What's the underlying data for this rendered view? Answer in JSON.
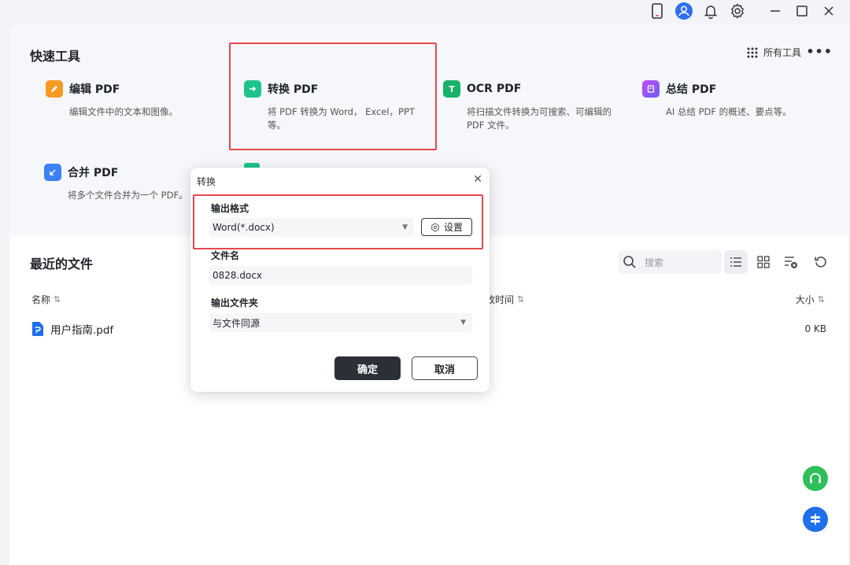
{
  "titlebar": {
    "icons": [
      "phone-icon",
      "user-avatar-icon",
      "bell-icon",
      "gear-icon",
      "minimize-icon",
      "maximize-icon",
      "close-icon"
    ]
  },
  "quick_tools": {
    "title": "快速工具",
    "all_tools_label": "所有工具",
    "more_label": "•••",
    "tools": [
      {
        "name": "编辑 PDF",
        "desc": "编辑文件中的文本和图像。",
        "color": "#f59a23"
      },
      {
        "name": "转换 PDF",
        "desc": "将 PDF 转换为 Word， Excel，PPT 等。",
        "color": "#1ec38b"
      },
      {
        "name": "OCR PDF",
        "desc": "将扫描文件转换为可搜索、可编辑的 PDF 文件。",
        "color": "#17b26a",
        "icon_text": "T"
      },
      {
        "name": "总结 PDF",
        "desc": "AI 总结 PDF 的概述、要点等。",
        "color": "#8b5cf6"
      },
      {
        "name": "合并 PDF",
        "desc": "将多个文件合并为一个 PDF。",
        "color": "#3b82f6"
      }
    ]
  },
  "recent": {
    "title": "最近的文件",
    "search_placeholder": "搜索",
    "columns": {
      "name": "名称",
      "modified": "改时间",
      "size": "大小"
    },
    "sort_glyph": "⇅",
    "files": [
      {
        "name": "用户指南.pdf",
        "size": "0 KB"
      }
    ]
  },
  "dialog": {
    "title": "转换",
    "close_glyph": "✕",
    "output_format_label": "输出格式",
    "output_format_value": "Word(*.docx)",
    "settings_label": "设置",
    "file_name_label": "文件名",
    "file_name_value": "0828.docx",
    "output_folder_label": "输出文件夹",
    "output_folder_value": "与文件同源",
    "confirm_label": "确定",
    "cancel_label": "取消"
  },
  "colors": {
    "highlight": "#e5484d",
    "primary_button": "#2b2f36",
    "support_button": "#2fbf5a",
    "float_button": "#1f6fea"
  }
}
